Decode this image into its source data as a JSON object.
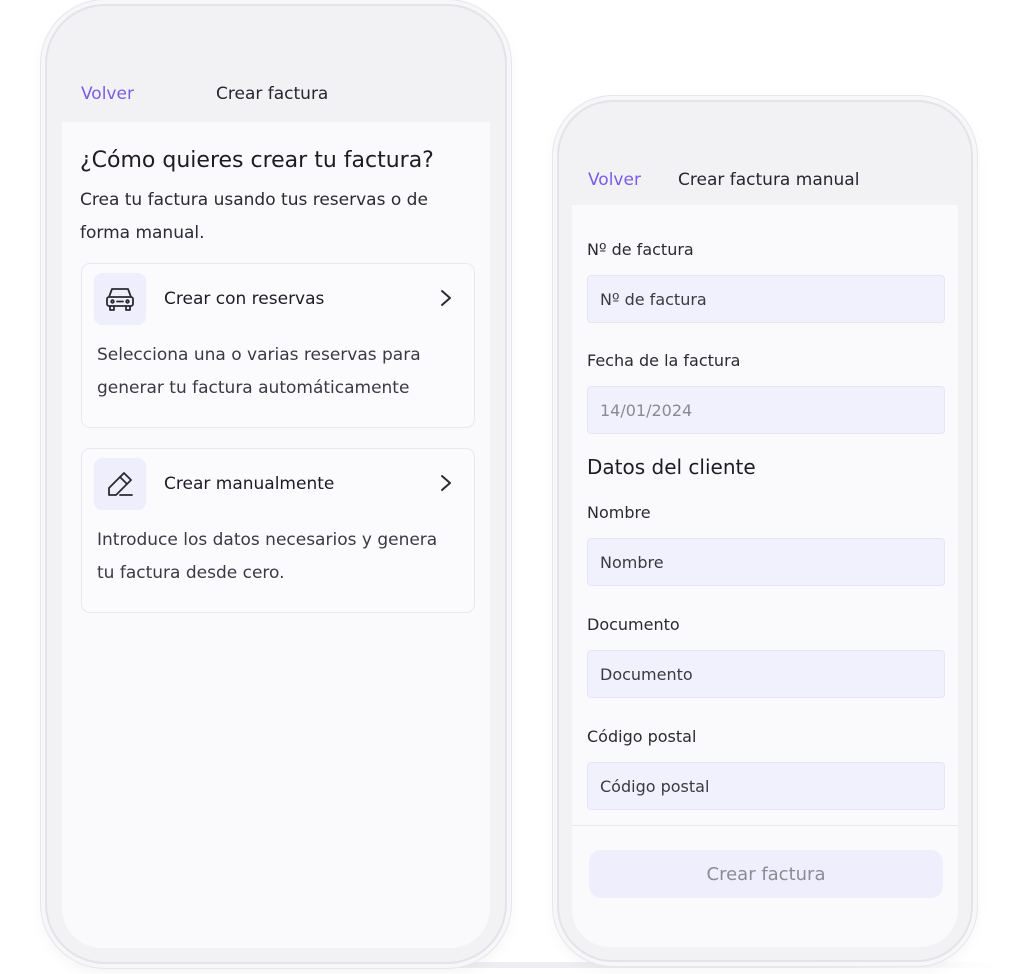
{
  "left_screen": {
    "nav": {
      "back_label": "Volver",
      "title": "Crear factura"
    },
    "heading": "¿Cómo quieres crear tu factura?",
    "subheading": "Crea tu factura usando tus reservas o de forma manual.",
    "options": [
      {
        "icon": "car-icon",
        "title": "Crear con reservas",
        "description": "Selecciona una o varias reservas para generar tu factura automáticamente"
      },
      {
        "icon": "pencil-icon",
        "title": "Crear manualmente",
        "description": "Introduce los datos necesarios y genera tu factura desde cero."
      }
    ]
  },
  "right_screen": {
    "nav": {
      "back_label": "Volver",
      "title": "Crear factura manual"
    },
    "invoice_number": {
      "label": "Nº de factura",
      "placeholder": "Nº de factura"
    },
    "invoice_date": {
      "label": "Fecha de la factura",
      "value": "14/01/2024"
    },
    "client_section_title": "Datos del cliente",
    "client_name": {
      "label": "Nombre",
      "placeholder": "Nombre"
    },
    "client_document": {
      "label": "Documento",
      "placeholder": "Documento"
    },
    "client_postal_code": {
      "label": "Código postal",
      "placeholder": "Código postal"
    },
    "submit_label": "Crear factura"
  },
  "colors": {
    "accent": "#7a5ce6",
    "input_bg": "#f1f0fd",
    "icon_bg": "#eeeefc",
    "screen_bg": "#fafafc",
    "frame_bg": "#f2f2f4"
  }
}
